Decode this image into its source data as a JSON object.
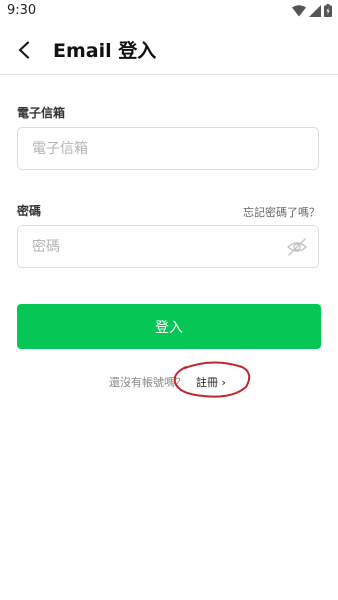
{
  "status_bar": {
    "time": "9:30",
    "icons": [
      "wifi-icon",
      "signal-icon",
      "battery-icon"
    ]
  },
  "header": {
    "back_icon": "back-arrow-icon",
    "title": "Email 登入"
  },
  "form": {
    "email": {
      "label": "電子信箱",
      "placeholder": "電子信箱",
      "value": ""
    },
    "password": {
      "label": "密碼",
      "placeholder": "密碼",
      "value": "",
      "forgot_label": "忘記密碼了嗎？",
      "visibility_icon": "eye-off-icon"
    },
    "submit_label": "登入"
  },
  "signup": {
    "prompt": "還沒有帳號嗎？",
    "link_label": "註冊 ›"
  },
  "colors": {
    "primary_button": "#06c755",
    "annotation_circle": "#c0262d"
  }
}
